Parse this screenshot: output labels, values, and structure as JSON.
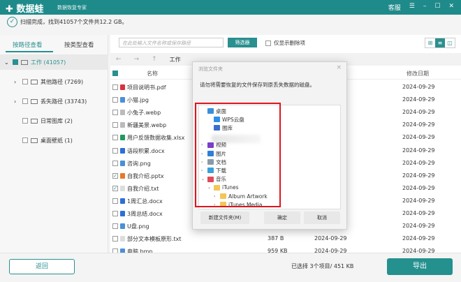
{
  "app": {
    "logo": "✚ 数据蛙",
    "subtitle": "数据恢复专家",
    "support": "客服",
    "menu_icon": "☰",
    "min_icon": "–",
    "max_icon": "☐",
    "close_icon": "✕"
  },
  "status": {
    "icon": "✓",
    "text": "扫描完成，找到41057个文件共12.2 GB。"
  },
  "sidebar": {
    "tabs": [
      "按路径查看",
      "按类型查看"
    ],
    "items": [
      {
        "label": "工作 (41057)",
        "arrow": "⌄",
        "checked": "partial",
        "level": 0
      },
      {
        "label": "其他路径 (7269)",
        "arrow": "›",
        "level": 1
      },
      {
        "label": "丢失路径 (33743)",
        "arrow": "›",
        "level": 1
      },
      {
        "label": "日常图库 (2)",
        "arrow": "",
        "level": 1
      },
      {
        "label": "桌面壁纸 (1)",
        "arrow": "",
        "level": 1
      }
    ]
  },
  "toolbar": {
    "search_placeholder": "在此处输入文件名称或保存路径",
    "filter": "筛选器",
    "only_deleted": "仅显示删除项",
    "back": "←",
    "forward": "→",
    "up": "↑",
    "crumb": "工作"
  },
  "table": {
    "headers": {
      "name": "名称",
      "modified": "修改日期"
    },
    "rows": [
      {
        "name": "项目说明书.pdf",
        "color": "#d9323a",
        "checked": false,
        "size": "",
        "created": "",
        "modified": "2024-09-29"
      },
      {
        "name": "小猫.jpg",
        "color": "#4a8fd8",
        "checked": false,
        "size": "",
        "created": "",
        "modified": "2024-09-29"
      },
      {
        "name": "小兔子.webp",
        "color": "#bbbbbb",
        "checked": false,
        "size": "",
        "created": "",
        "modified": "2024-09-29"
      },
      {
        "name": "新疆美景.webp",
        "color": "#bbbbbb",
        "checked": false,
        "size": "",
        "created": "",
        "modified": "2024-09-29"
      },
      {
        "name": "用户反馈数据收集.xlsx",
        "color": "#1f9a5a",
        "checked": false,
        "size": "",
        "created": "",
        "modified": "2024-09-29"
      },
      {
        "name": "语段积累.docx",
        "color": "#2d6fd6",
        "checked": false,
        "size": "",
        "created": "",
        "modified": "2024-09-29"
      },
      {
        "name": "咨询.png",
        "color": "#4a8fd8",
        "checked": false,
        "size": "",
        "created": "",
        "modified": "2024-09-29"
      },
      {
        "name": "自我介绍.pptx",
        "color": "#e8782a",
        "checked": true,
        "size": "",
        "created": "",
        "modified": "2024-09-29"
      },
      {
        "name": "自我介绍.txt",
        "color": "#dddddd",
        "checked": true,
        "size": "",
        "created": "",
        "modified": "2024-09-29"
      },
      {
        "name": "1周汇总.docx",
        "color": "#2d6fd6",
        "checked": false,
        "size": "",
        "created": "",
        "modified": "2024-09-29"
      },
      {
        "name": "3周总结.docx",
        "color": "#2d6fd6",
        "checked": false,
        "size": "",
        "created": "",
        "modified": "2024-09-29"
      },
      {
        "name": "U盘.png",
        "color": "#4a8fd8",
        "checked": false,
        "size": "",
        "created": "",
        "modified": "2024-09-29"
      },
      {
        "name": "部分文本模板原形.txt",
        "color": "#dddddd",
        "checked": false,
        "size": "387 B",
        "created": "2024-09-29",
        "modified": "2024-09-29"
      },
      {
        "name": "电脑.bmp",
        "color": "#4a8fd8",
        "checked": false,
        "size": "959 KB",
        "created": "2024-09-29",
        "modified": "2024-09-29"
      }
    ]
  },
  "footer": {
    "back": "返回",
    "selection": "已选择 3个项目/ 451 KB",
    "export": "导出"
  },
  "dialog": {
    "title": "浏览文件夹",
    "close": "×",
    "message": "请勿将需要恢复的文件保存到原丢失数据的磁盘。",
    "tree": [
      {
        "label": "桌面",
        "indent": 0,
        "arrow": "",
        "color": "#3a8fd8"
      },
      {
        "label": "WPS云盘",
        "indent": 1,
        "arrow": "",
        "color": "#2f8fe8"
      },
      {
        "label": "图库",
        "indent": 1,
        "arrow": "",
        "color": "#3a6fd0"
      },
      {
        "label": "",
        "indent": 1,
        "arrow": "",
        "color": ""
      },
      {
        "label": "视频",
        "indent": 0,
        "arrow": "›",
        "color": "#7a3fc8"
      },
      {
        "label": "图片",
        "indent": 0,
        "arrow": "›",
        "color": "#2f7fd8"
      },
      {
        "label": "文档",
        "indent": 0,
        "arrow": "›",
        "color": "#8a9aa8"
      },
      {
        "label": "下载",
        "indent": 0,
        "arrow": "›",
        "color": "#3aa0d8"
      },
      {
        "label": "音乐",
        "indent": 0,
        "arrow": "⌄",
        "color": "#e04a5a"
      },
      {
        "label": "iTunes",
        "indent": 1,
        "arrow": "⌄",
        "color": "#f2c75a"
      },
      {
        "label": "Album Artwork",
        "indent": 2,
        "arrow": "›",
        "color": "#f2c75a"
      },
      {
        "label": "iTunes Media",
        "indent": 2,
        "arrow": "›",
        "color": "#f2c75a"
      }
    ],
    "buttons": {
      "new_folder": "新建文件夹(M)",
      "ok": "确定",
      "cancel": "取消"
    }
  },
  "colors": {
    "accent": "#1f8a8a",
    "highlight": "#e0141e"
  }
}
